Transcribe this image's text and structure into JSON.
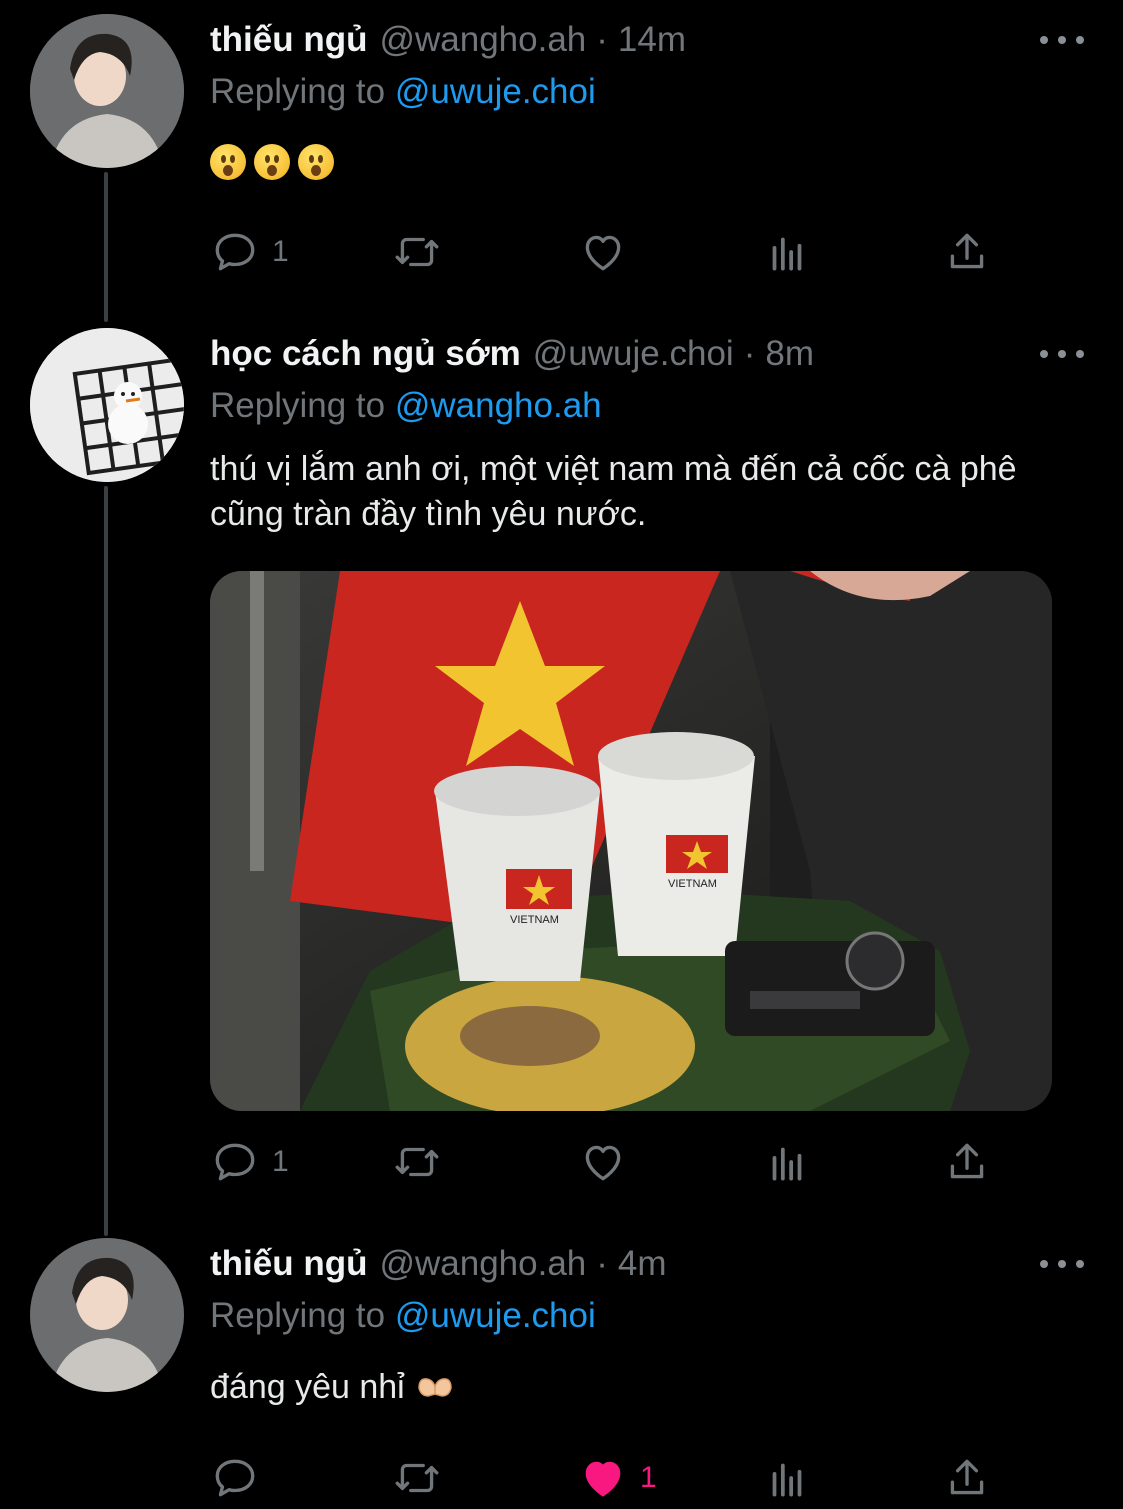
{
  "tweets": [
    {
      "name": "thiếu ngủ",
      "handle": "@wangho.ah",
      "separator": "·",
      "time": "14m",
      "replying_prefix": "Replying to",
      "replying_to": "@uwuje.choi",
      "text": "",
      "emoji": [
        "astonished-face-emoji",
        "astonished-face-emoji",
        "astonished-face-emoji"
      ],
      "stats": {
        "replies": "1",
        "retweets": "",
        "likes": ""
      },
      "liked": false
    },
    {
      "name": "học cách ngủ sớm",
      "handle": "@uwuje.choi",
      "separator": "·",
      "time": "8m",
      "replying_prefix": "Replying to",
      "replying_to": "@wangho.ah",
      "text": "thú vị lắm anh ơi, một việt nam mà đến cả cốc cà phê cũng tràn đầy tình yêu nước.",
      "media": {
        "type": "photo",
        "cup_label_1": "VIETNAM",
        "cup_label_2": "VIETNAM"
      },
      "stats": {
        "replies": "1",
        "retweets": "",
        "likes": ""
      },
      "liked": false
    },
    {
      "name": "thiếu ngủ",
      "handle": "@wangho.ah",
      "separator": "·",
      "time": "4m",
      "replying_prefix": "Replying to",
      "replying_to": "@uwuje.choi",
      "text": "đáng yêu nhỉ",
      "text_emoji": "heart-hands-emoji",
      "stats": {
        "replies": "",
        "retweets": "",
        "likes": "1"
      },
      "liked": true
    }
  ],
  "colors": {
    "background": "#000000",
    "text": "#e7e9ea",
    "secondary": "#71767b",
    "link": "#1d9bf0",
    "like": "#f91880",
    "thread_line": "#3a3f44"
  },
  "icons": [
    "reply-icon",
    "retweet-icon",
    "like-icon",
    "analytics-icon",
    "share-icon",
    "more-icon"
  ]
}
